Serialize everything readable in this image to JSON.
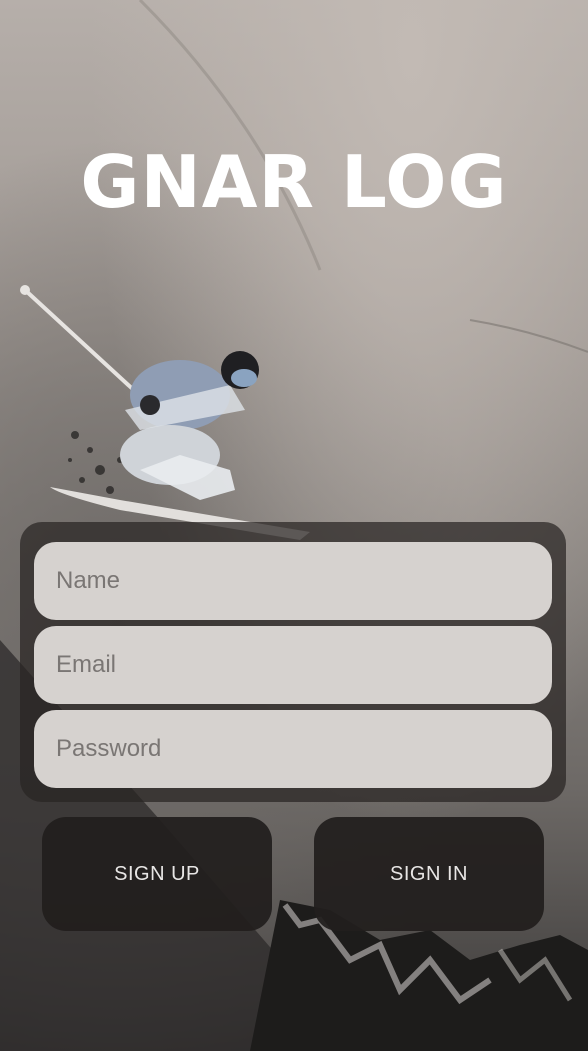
{
  "app": {
    "title": "GNAR LOG"
  },
  "form": {
    "name_placeholder": "Name",
    "email_placeholder": "Email",
    "password_placeholder": "Password"
  },
  "buttons": {
    "sign_up": "SIGN UP",
    "sign_in": "SIGN IN"
  },
  "colors": {
    "field_bg": "#d6d2cf",
    "button_bg": "#211e1d",
    "title": "#ffffff"
  }
}
